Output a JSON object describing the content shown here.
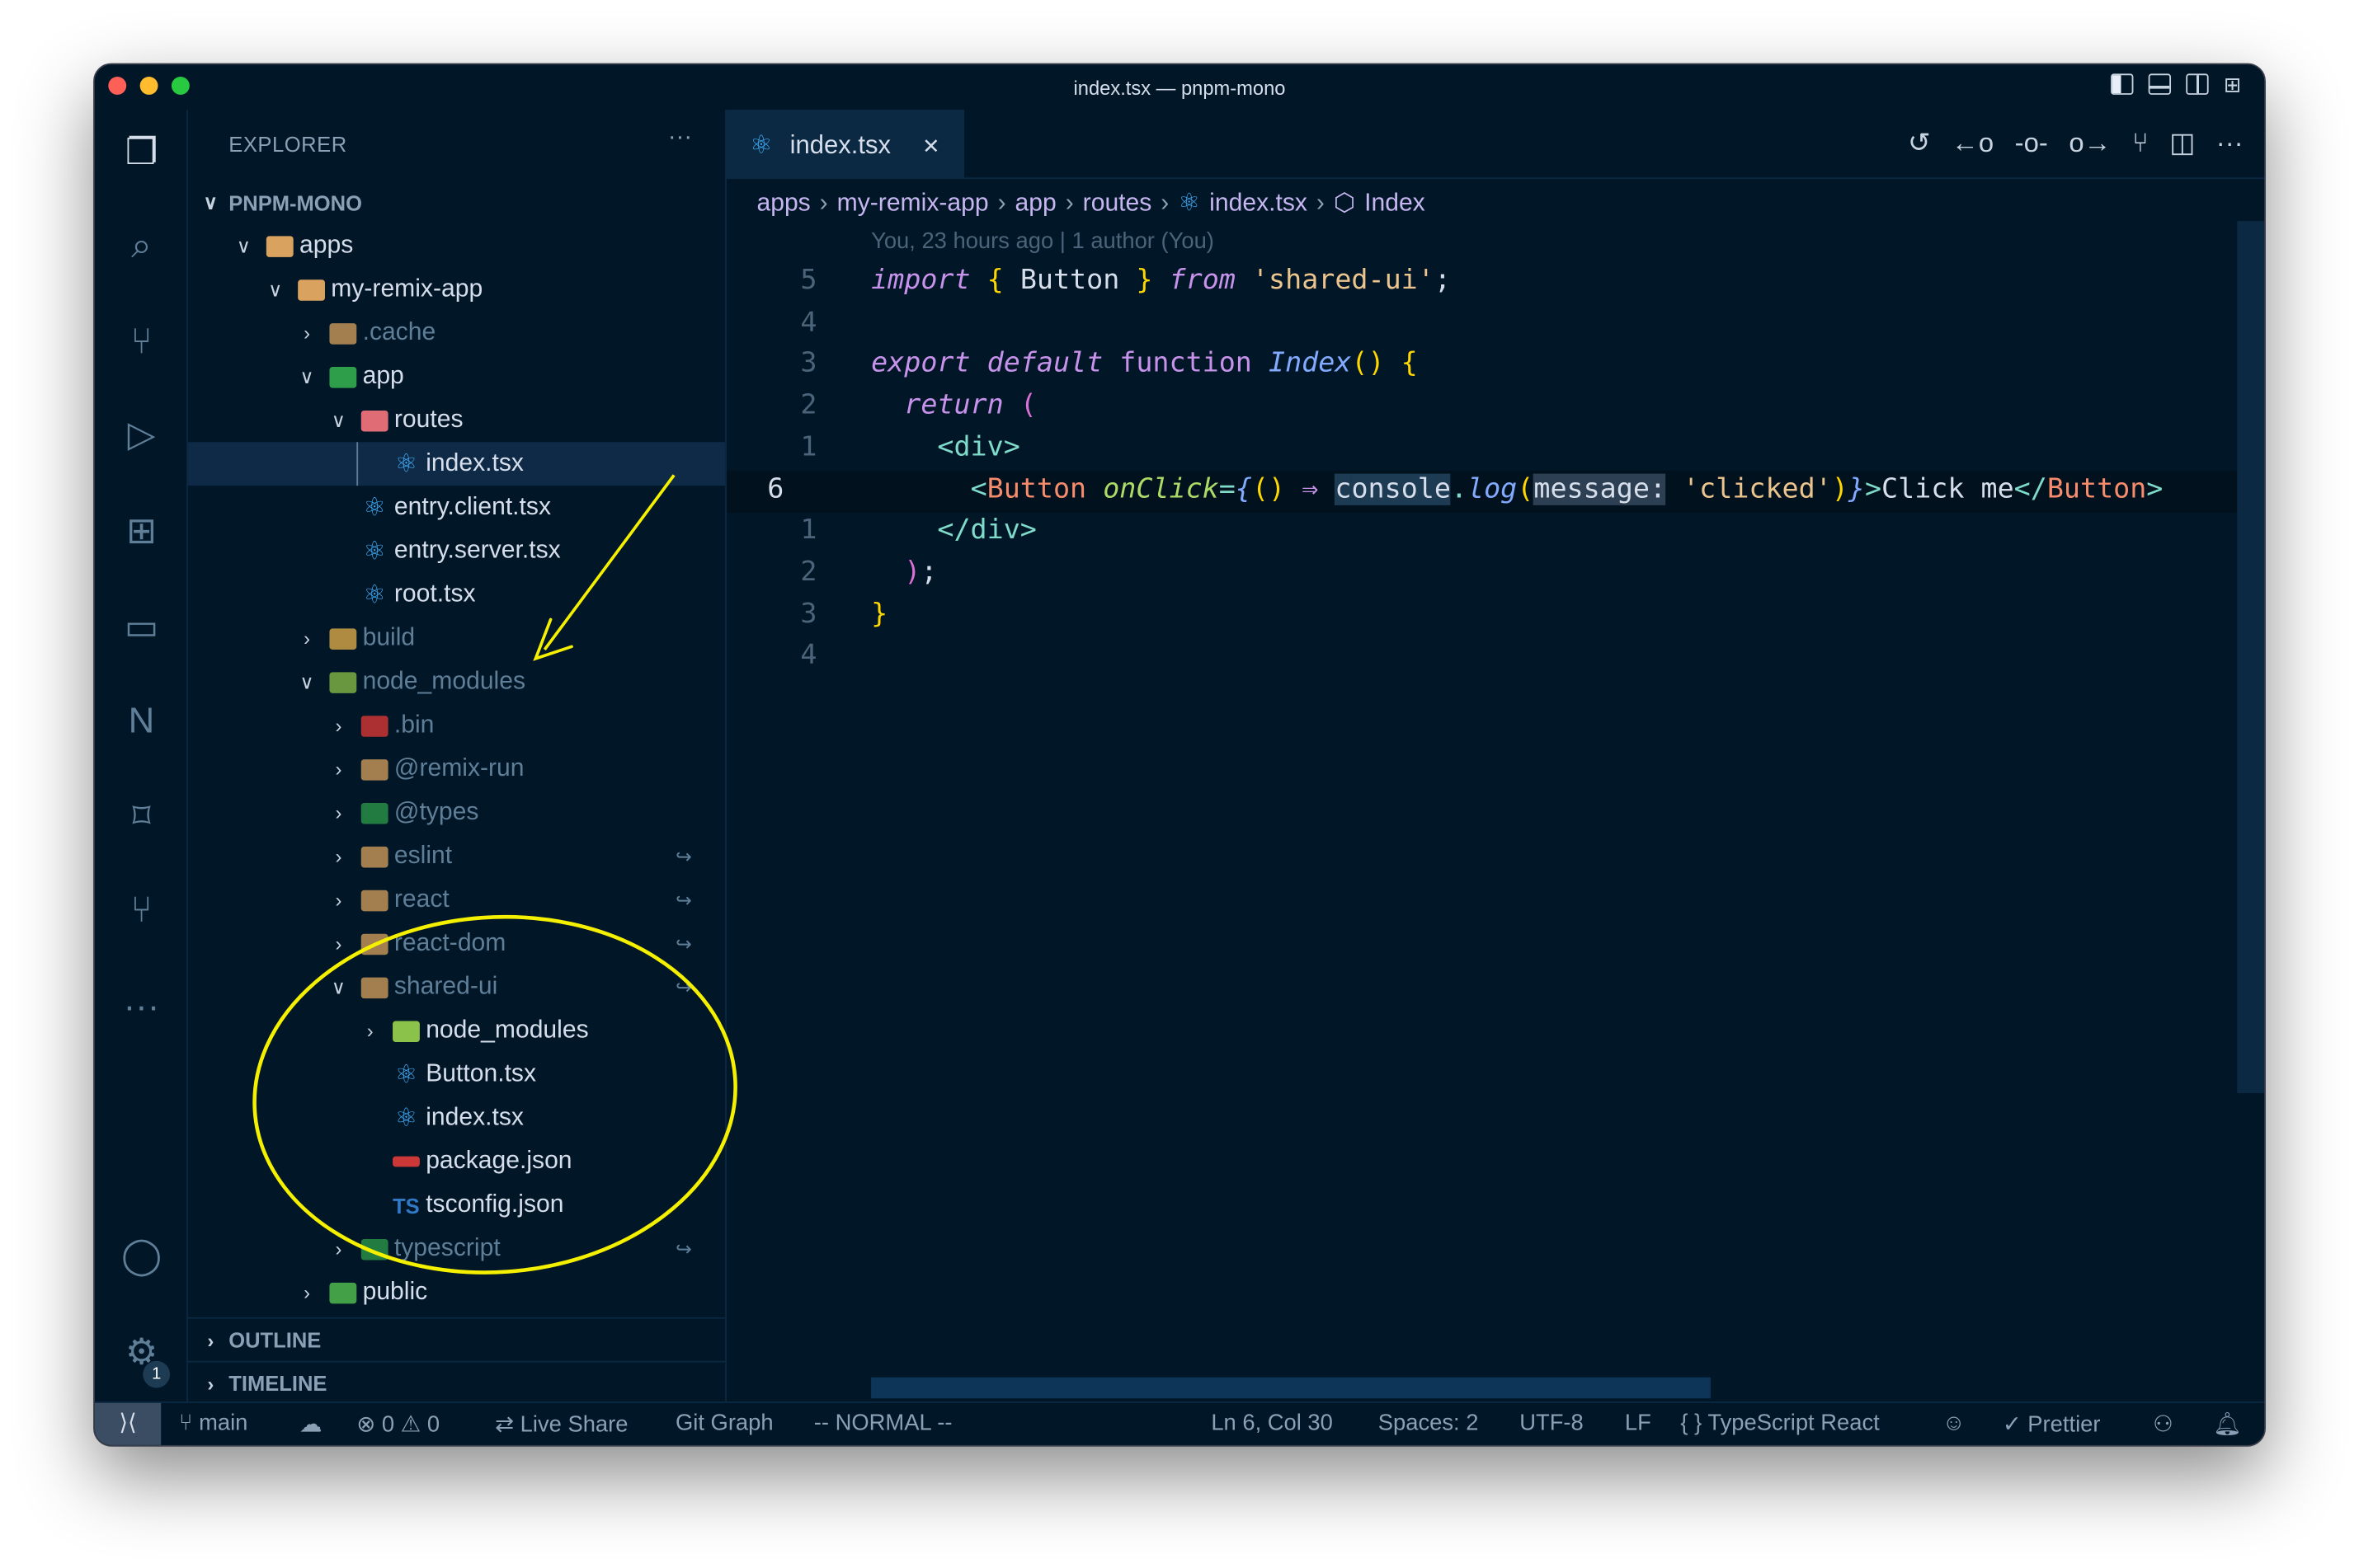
{
  "window": {
    "title": "index.tsx — pnpm-mono"
  },
  "colors": {
    "background": "#011627",
    "accent": "#40a9f3",
    "annotation": "#f5f000"
  },
  "activity_bar": [
    "files-icon",
    "search-icon",
    "source-control-icon",
    "run-debug-icon",
    "extensions-icon",
    "remote-explorer-icon",
    "nx-icon",
    "bookmarks-icon",
    "git-graph-icon",
    "more-icon",
    "account-icon",
    "settings-icon"
  ],
  "settings_badge": "1",
  "explorer": {
    "title": "EXPLORER",
    "more": "···",
    "root": "PNPM-MONO",
    "items": [
      {
        "label": "apps",
        "level": 0,
        "chevron": "open",
        "icon": "folder"
      },
      {
        "label": "my-remix-app",
        "level": 1,
        "chevron": "open",
        "icon": "folder"
      },
      {
        "label": ".cache",
        "level": 2,
        "chevron": "closed",
        "icon": "folder",
        "dim": true
      },
      {
        "label": "app",
        "level": 2,
        "chevron": "open",
        "icon": "folder-app"
      },
      {
        "label": "routes",
        "level": 3,
        "chevron": "open",
        "icon": "folder-routes"
      },
      {
        "label": "index.tsx",
        "level": 4,
        "icon": "react",
        "selected": true
      },
      {
        "label": "entry.client.tsx",
        "level": 3,
        "icon": "react"
      },
      {
        "label": "entry.server.tsx",
        "level": 3,
        "icon": "react"
      },
      {
        "label": "root.tsx",
        "level": 3,
        "icon": "react"
      },
      {
        "label": "build",
        "level": 2,
        "chevron": "closed",
        "icon": "folder-build",
        "dim": true
      },
      {
        "label": "node_modules",
        "level": 2,
        "chevron": "open",
        "icon": "folder-node",
        "dim": true
      },
      {
        "label": ".bin",
        "level": 3,
        "chevron": "closed",
        "icon": "folder-bin",
        "dim": true
      },
      {
        "label": "@remix-run",
        "level": 3,
        "chevron": "closed",
        "icon": "folder",
        "dim": true
      },
      {
        "label": "@types",
        "level": 3,
        "chevron": "closed",
        "icon": "folder-ts",
        "dim": true
      },
      {
        "label": "eslint",
        "level": 3,
        "chevron": "closed",
        "icon": "folder",
        "dim": true,
        "symlink": true
      },
      {
        "label": "react",
        "level": 3,
        "chevron": "closed",
        "icon": "folder",
        "dim": true,
        "symlink": true
      },
      {
        "label": "react-dom",
        "level": 3,
        "chevron": "closed",
        "icon": "folder",
        "dim": true,
        "symlink": true
      },
      {
        "label": "shared-ui",
        "level": 3,
        "chevron": "open",
        "icon": "folder",
        "dim": true,
        "symlink": true
      },
      {
        "label": "node_modules",
        "level": 4,
        "chevron": "closed",
        "icon": "folder-node"
      },
      {
        "label": "Button.tsx",
        "level": 4,
        "icon": "react"
      },
      {
        "label": "index.tsx",
        "level": 4,
        "icon": "react"
      },
      {
        "label": "package.json",
        "level": 4,
        "icon": "npm"
      },
      {
        "label": "tsconfig.json",
        "level": 4,
        "icon": "tsconfig"
      },
      {
        "label": "typescript",
        "level": 3,
        "chevron": "closed",
        "icon": "folder-ts",
        "dim": true,
        "symlink": true
      },
      {
        "label": "public",
        "level": 2,
        "chevron": "closed",
        "icon": "folder-public"
      }
    ],
    "sections": [
      "OUTLINE",
      "TIMELINE"
    ]
  },
  "tab": {
    "label": "index.tsx",
    "close": "✕"
  },
  "editor_actions": [
    "timeline-icon",
    "previous-change-icon",
    "commit-icon",
    "next-change-icon",
    "git-graph-icon",
    "split-editor-icon",
    "more-icon"
  ],
  "breadcrumb": [
    "apps",
    "my-remix-app",
    "app",
    "routes",
    "index.tsx",
    "Index"
  ],
  "blame": "You, 23 hours ago | 1 author (You)",
  "code": [
    {
      "ln": "5",
      "tokens": [
        [
          "import",
          "kw"
        ],
        [
          " "
        ],
        [
          "{",
          "br"
        ],
        [
          " Button "
        ],
        [
          "}",
          "br"
        ],
        [
          " "
        ],
        [
          "from",
          "kw"
        ],
        [
          " "
        ],
        [
          "'shared-ui'",
          "str"
        ],
        [
          ";"
        ]
      ]
    },
    {
      "ln": "4",
      "tokens": []
    },
    {
      "ln": "3",
      "tokens": [
        [
          "export",
          "kw"
        ],
        [
          " "
        ],
        [
          "default",
          "kw"
        ],
        [
          " "
        ],
        [
          "function",
          "op"
        ],
        [
          " "
        ],
        [
          "Index",
          "fn"
        ],
        [
          "()",
          "br"
        ],
        [
          " "
        ],
        [
          "{",
          "br"
        ]
      ]
    },
    {
      "ln": "2",
      "tokens": [
        [
          "  "
        ],
        [
          "return",
          "kw"
        ],
        [
          " "
        ],
        [
          "(",
          "pr"
        ]
      ]
    },
    {
      "ln": "1",
      "tokens": [
        [
          "    "
        ],
        [
          "<div>",
          "tag"
        ]
      ]
    },
    {
      "ln": "6",
      "current": true,
      "tokens": [
        [
          "      "
        ],
        [
          "<",
          "tag"
        ],
        [
          "Button",
          "comp"
        ],
        [
          " "
        ],
        [
          "onClick",
          "attr"
        ],
        [
          "=",
          "tag"
        ],
        [
          "{",
          "fn"
        ],
        [
          "()",
          "br"
        ],
        [
          " "
        ],
        [
          "⇒",
          "op"
        ],
        [
          " "
        ],
        [
          "c",
          "selw"
        ],
        [
          "onsole",
          "selw"
        ],
        [
          ".",
          "tag"
        ],
        [
          "log",
          "fn"
        ],
        [
          "(",
          "br"
        ],
        [
          "message:",
          "hint"
        ],
        [
          " "
        ],
        [
          "'clicked'",
          "str"
        ],
        [
          ")",
          "br"
        ],
        [
          "}",
          "fn"
        ],
        [
          ">",
          "tag"
        ],
        [
          "Click me"
        ],
        [
          "</",
          "tag"
        ],
        [
          "Button",
          "comp"
        ],
        [
          ">",
          "tag"
        ]
      ]
    },
    {
      "ln": "1",
      "tokens": [
        [
          "    "
        ],
        [
          "</div>",
          "tag"
        ]
      ]
    },
    {
      "ln": "2",
      "tokens": [
        [
          "  "
        ],
        [
          ")",
          "pr"
        ],
        [
          ";"
        ]
      ]
    },
    {
      "ln": "3",
      "tokens": [
        [
          "}",
          "br"
        ]
      ]
    },
    {
      "ln": "4",
      "tokens": []
    }
  ],
  "status": {
    "branch": "main",
    "errors": "0",
    "warnings": "0",
    "live_share": "Live Share",
    "git_graph": "Git Graph",
    "mode": "-- NORMAL --",
    "position": "Ln 6, Col 30",
    "spaces": "Spaces: 2",
    "encoding": "UTF-8",
    "eol": "LF",
    "language": "TypeScript React",
    "prettier": "Prettier"
  }
}
